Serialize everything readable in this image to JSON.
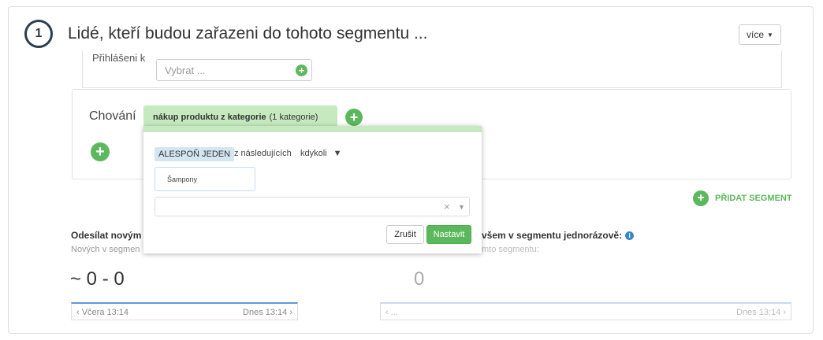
{
  "section": {
    "step_number": "1",
    "title": "Lidé, kteří budou zařazeni do tohoto segmentu ...",
    "more_label": "více"
  },
  "login": {
    "label": "Přihlášeni k",
    "select_placeholder": "Vybrat ..."
  },
  "behavior": {
    "label": "Chování",
    "tab_bold": "nákup produktu z kategorie",
    "tab_count": "(1 kategorie)"
  },
  "popup": {
    "at_least_label": "ALESPOŇ JEDEN",
    "from_following": "z následujících",
    "anytime_label": "kdykoli",
    "category_chip": "Šampony",
    "clear_symbol": "×",
    "cancel_label": "Zrušit",
    "set_label": "Nastavit"
  },
  "add_segment_label": "PŘIDAT SEGMENT",
  "sending": {
    "new_label": "Odesílat novým",
    "new_sub": "Nových v segmen",
    "all_label": "všem v segmentu jednorázově:",
    "all_sub": "mto segmentu:",
    "count_left": "~ 0 - 0",
    "count_right": "0",
    "range_left_start": "‹ Včera 13:14",
    "range_left_end": "Dnes 13:14 ›",
    "range_right_start": "‹ ...",
    "range_right_end": "Dnes 13:14 ›"
  },
  "colors": {
    "accent_green": "#5cb85c",
    "tab_green": "#c7e9c0",
    "info_blue": "#3a87c8"
  }
}
